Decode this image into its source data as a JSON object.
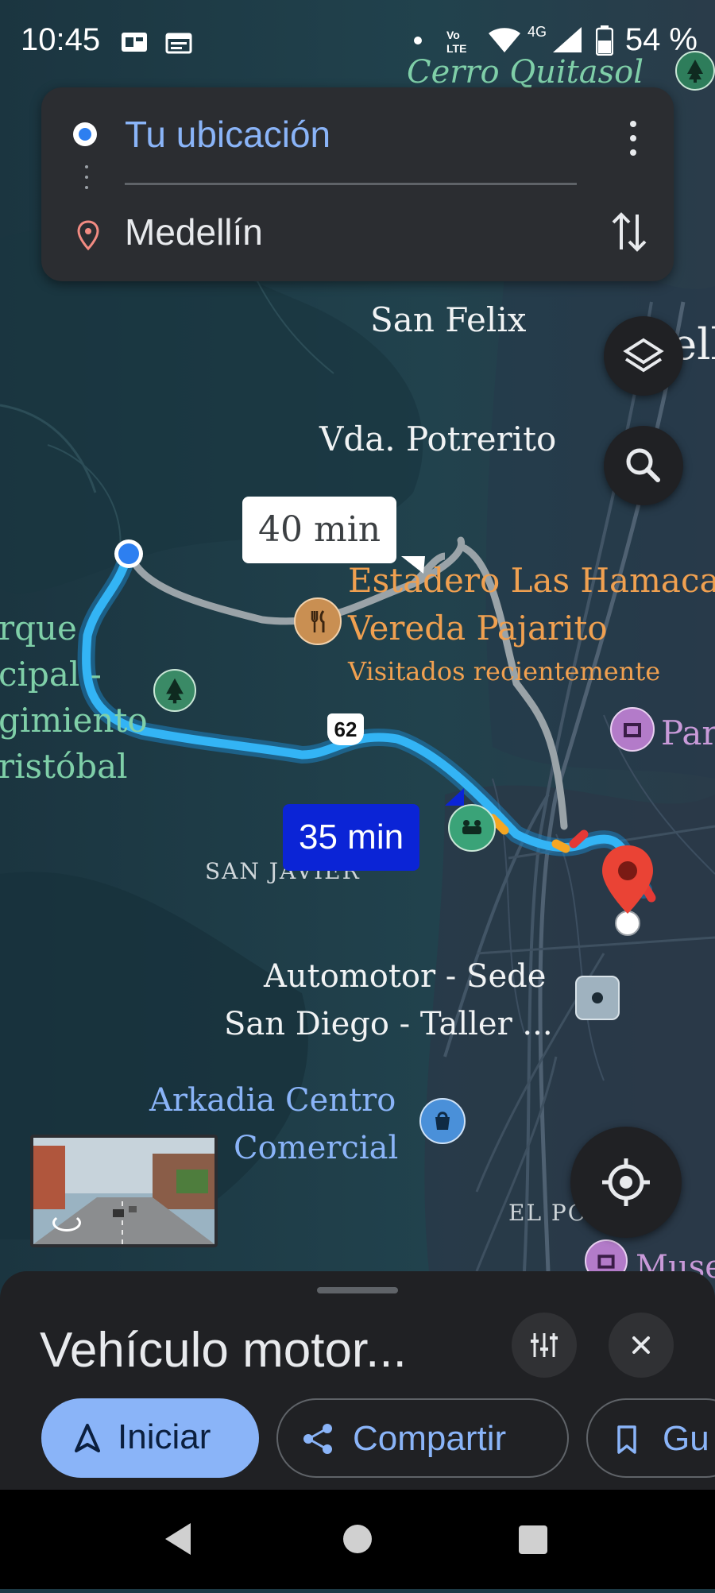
{
  "status_bar": {
    "time": "10:45",
    "signal_text": "4G",
    "battery": "54 %",
    "icons": [
      "sim-icon",
      "calendar-icon",
      "volte-icon",
      "wifi-icon",
      "signal-icon",
      "battery-icon"
    ]
  },
  "directions": {
    "origin": "Tu ubicación",
    "destination": "Medellín"
  },
  "map": {
    "labels": {
      "cerro": "Cerro Quitasol",
      "san_felix": "San Felix",
      "medellin_partial": "Mello",
      "potrerito": "Vda. Potrerito",
      "estadero": "Estadero Las Hamaca",
      "vereda": "Vereda Pajarito",
      "visitados": "Visitados recientemente",
      "parque_1": "rque",
      "parque_2": "cipal -",
      "parque_3": "gimiento",
      "parque_4": "ristóbal",
      "parque_right": "Par",
      "route_shield": "62",
      "san_javier": "SAN JAVIER",
      "automotor_1": "Automotor - Sede",
      "automotor_2": "San Diego - Taller ...",
      "arkadia_1": "Arkadia Centro",
      "arkadia_2": "Comercial",
      "el_poblado": "EL PO",
      "museo": "Muse"
    },
    "route_alt_time": "40 min",
    "route_main_time": "35 min",
    "colors": {
      "route_main": "#33b4f5",
      "route_alt": "#9aa3a8",
      "label_orange": "#f0a050",
      "label_blue": "#8ab4f8",
      "label_green": "#7fcfa8",
      "map_bg": "#1d3a45"
    }
  },
  "bottom_sheet": {
    "title": "Vehículo motor...",
    "start": "Iniciar",
    "share": "Compartir",
    "save_partial": "Gu"
  }
}
